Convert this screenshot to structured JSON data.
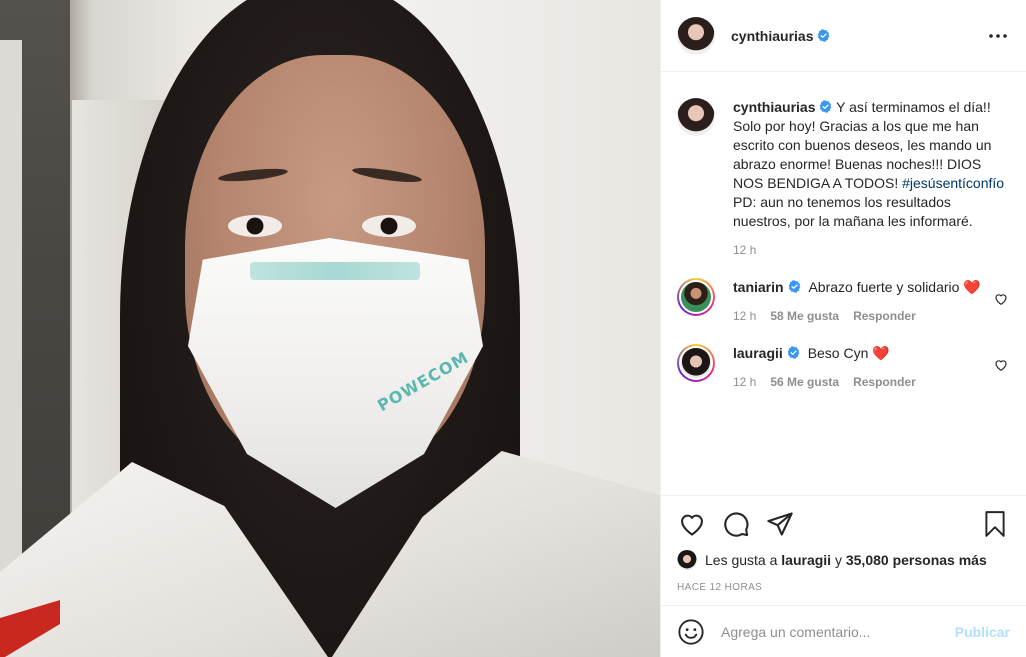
{
  "post": {
    "owner": {
      "username": "cynthiaurias",
      "verified": true,
      "avatar_icon": "profile-photo"
    },
    "photo": {
      "mask_text": "POWECOM"
    },
    "caption": {
      "username": "cynthiaurias",
      "text_before": "Y así terminamos el día!! Solo por hoy! Gracias a los que me han escrito con buenos deseos, les mando un abrazo enorme! Buenas noches!!! DIOS NOS BENDIGA A TODOS! ",
      "hashtag": "#jesúsentíconfío",
      "text_after": " PD: aun no tenemos los resultados nuestros, por la mañana les informaré.",
      "time": "12 h"
    },
    "comments": [
      {
        "username": "taniarin",
        "verified": true,
        "text": "Abrazo fuerte y solidario",
        "emoji": "❤️",
        "time": "12 h",
        "likes": "58 Me gusta",
        "reply": "Responder"
      },
      {
        "username": "lauragii",
        "verified": true,
        "text": "Beso Cyn",
        "emoji": "❤️",
        "time": "12 h",
        "likes": "56 Me gusta",
        "reply": "Responder"
      }
    ],
    "likes": {
      "prefix": "Les gusta a ",
      "user": "lauragii",
      "middle": " y ",
      "count": "35,080 personas más"
    },
    "time_ago": "HACE 12 HORAS",
    "add_comment": {
      "placeholder": "Agrega un comentario...",
      "publish": "Publicar"
    }
  },
  "colors": {
    "verified": "#3897f0",
    "heart": "#ed4956",
    "publish_disabled": "#b2dffc",
    "muted": "#8e8e8e"
  }
}
